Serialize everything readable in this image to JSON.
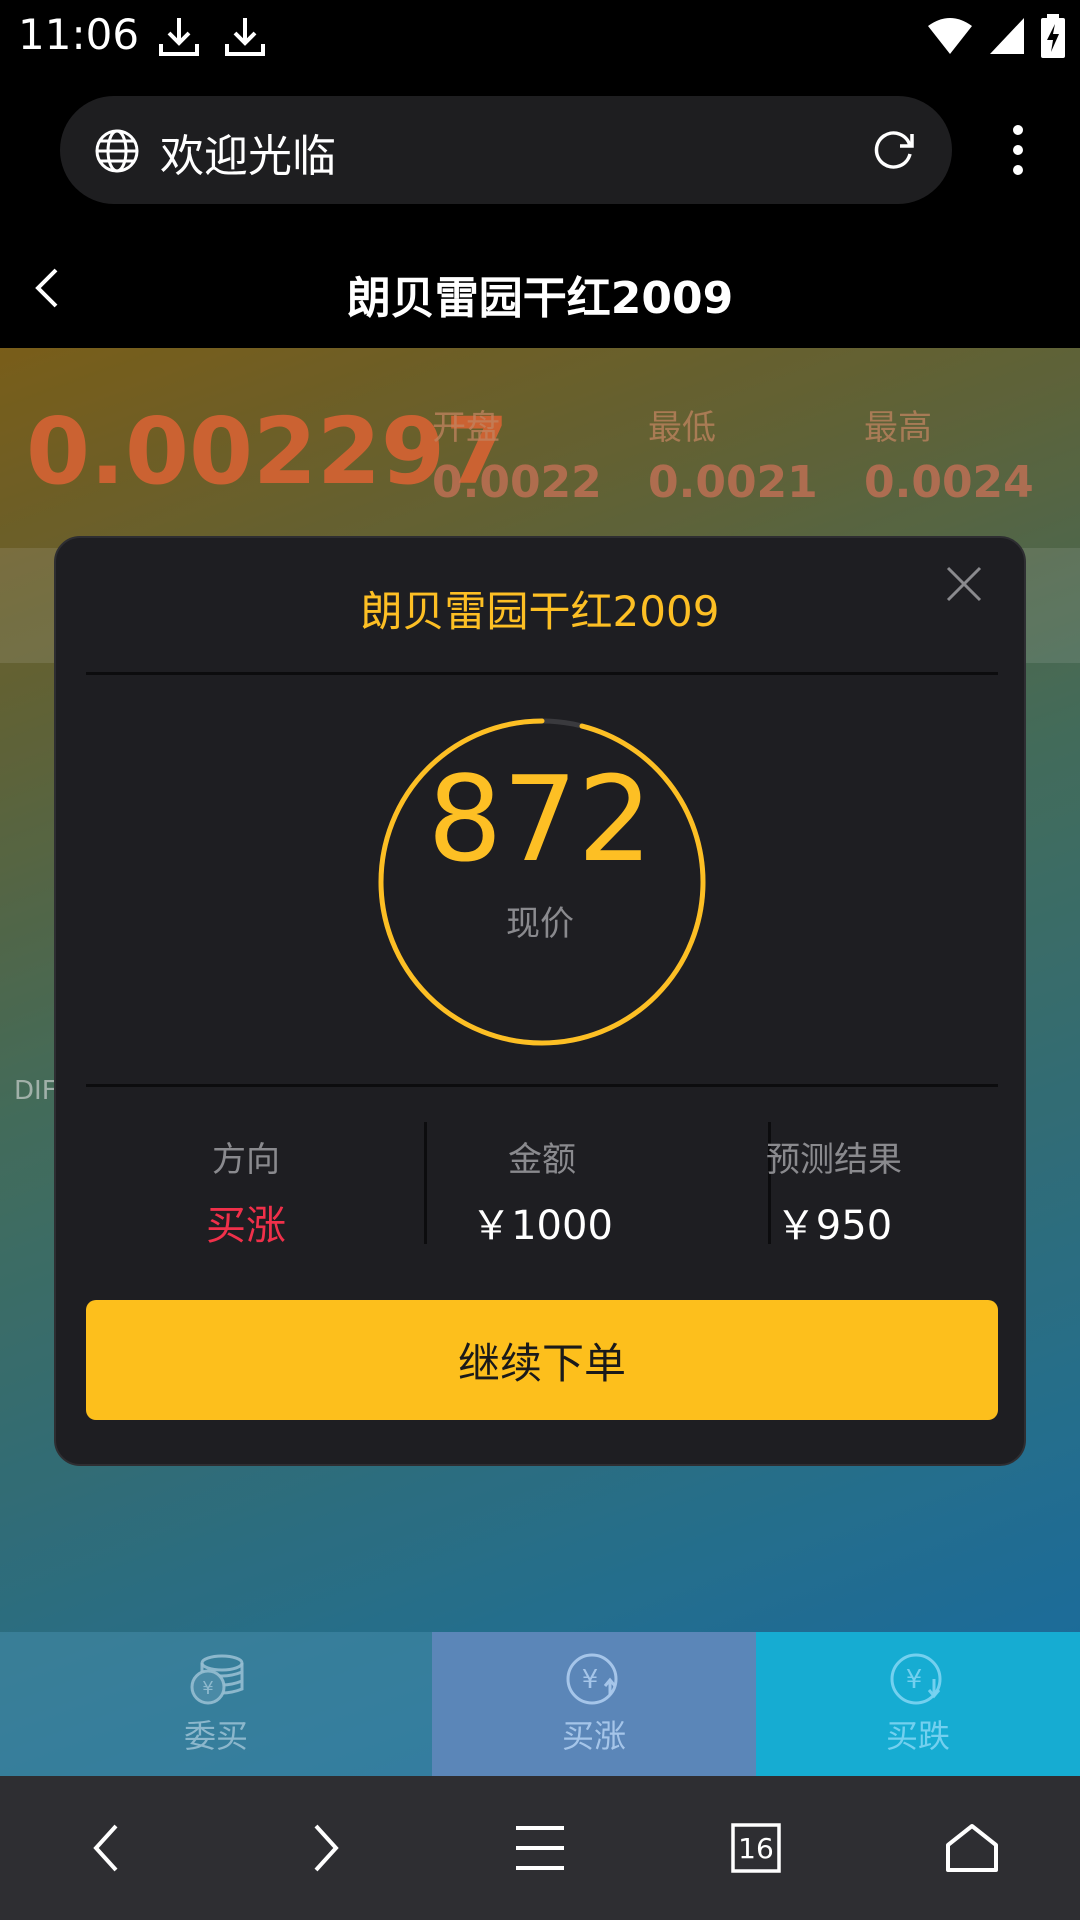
{
  "status_bar": {
    "time": "11:06"
  },
  "browser": {
    "url_title": "欢迎光临"
  },
  "header": {
    "title": "朗贝雷园干红2009"
  },
  "ticker": {
    "price": "0.002297",
    "stats": [
      {
        "label": "开盘",
        "value": "0.0022"
      },
      {
        "label": "最低",
        "value": "0.0021"
      },
      {
        "label": "最高",
        "value": "0.0024"
      }
    ],
    "side_label": "DIF"
  },
  "modal": {
    "title": "朗贝雷园干红2009",
    "countdown": "872",
    "countdown_label": "现价",
    "info": [
      {
        "label": "方向",
        "value": "买涨"
      },
      {
        "label": "金额",
        "value": "￥1000"
      },
      {
        "label": "预测结果",
        "value": "￥950"
      }
    ],
    "button": "继续下单",
    "accent": "#fdbf24"
  },
  "app_tabs": [
    {
      "label": "委买",
      "icon": "coins-stack-icon"
    },
    {
      "label": "买涨",
      "icon": "yuan-up-icon"
    },
    {
      "label": "买跌",
      "icon": "yuan-down-icon"
    }
  ],
  "browser_nav": {
    "tabs_count": "16"
  }
}
